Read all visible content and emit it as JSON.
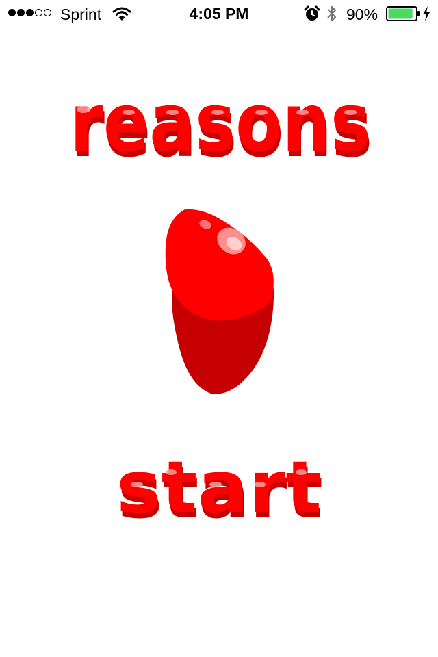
{
  "status_bar": {
    "signal_bars_filled": 3,
    "signal_bars_total": 5,
    "carrier": "Sprint",
    "time": "4:05 PM",
    "battery_percent": "90%",
    "battery_level": 0.9,
    "icons": [
      "wifi-icon",
      "alarm-icon",
      "bluetooth-icon",
      "battery-icon",
      "charging-bolt-icon"
    ]
  },
  "app": {
    "title": "reasons",
    "start_label": "start"
  },
  "colors": {
    "brand_red": "#ff0000",
    "shadow_red": "#c90000",
    "highlight_pink": "#ff9a9a",
    "battery_green": "#4cd964"
  }
}
